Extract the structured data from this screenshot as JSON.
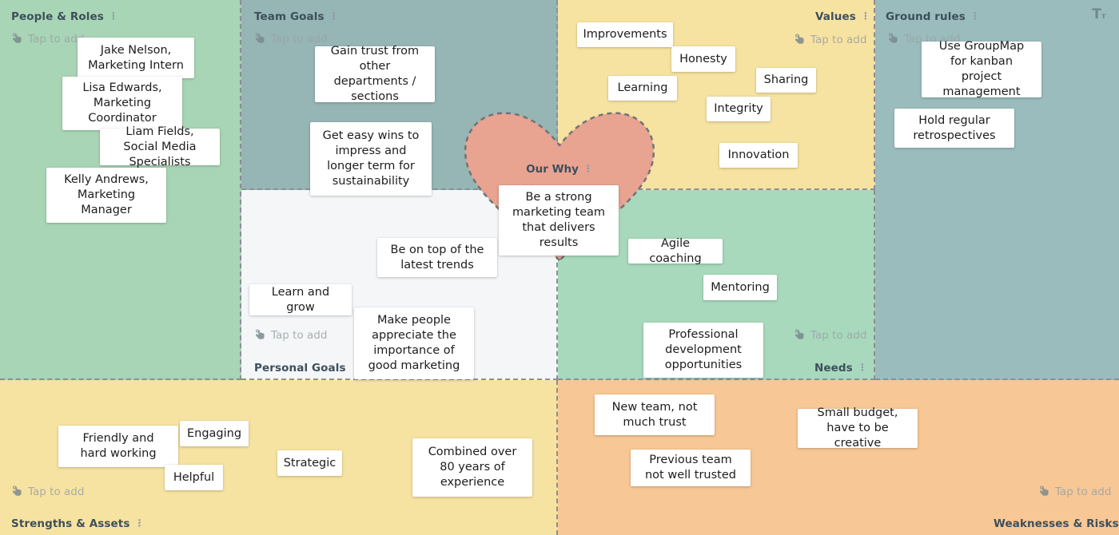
{
  "board": {
    "tap_to_add_label": "Tap to add",
    "menu_glyph": "⋮",
    "text_tool_label": "T",
    "text_tool_sub": "т"
  },
  "colors": {
    "people": "#a8d5b5",
    "team_goals": "#96b5b5",
    "personal_goals": "#f4f6f8",
    "values": "#f7e3a1",
    "needs": "#a8d9bd",
    "ground_rules": "#9bbcbc",
    "strengths": "#f7e3a1",
    "weaknesses": "#f7c795",
    "heart_fill": "#e8a391",
    "heart_stroke": "#6f7478",
    "title_text": "#3d4f5c",
    "card_bg": "#ffffff",
    "tap_text": "#9aa3a8"
  },
  "zones": {
    "people_roles": {
      "title": "People & Roles",
      "cards": [
        {
          "text": "Jake Nelson, Marketing Intern"
        },
        {
          "text": "Lisa Edwards, Marketing Coordinator"
        },
        {
          "text": "Liam Fields, Social Media Specialists"
        },
        {
          "text": "Kelly Andrews, Marketing Manager"
        }
      ]
    },
    "team_goals": {
      "title": "Team Goals",
      "cards": [
        {
          "text": "Gain trust from other departments / sections"
        },
        {
          "text": "Get easy wins to impress and longer term for sustainability"
        }
      ]
    },
    "personal_goals": {
      "title": "Personal Goals",
      "cards": [
        {
          "text": "Be on top of the latest trends"
        },
        {
          "text": "Learn and grow"
        },
        {
          "text": "Make people appreciate the importance of good marketing"
        }
      ]
    },
    "values": {
      "title": "Values",
      "cards": [
        {
          "text": "Improvements"
        },
        {
          "text": "Honesty"
        },
        {
          "text": "Sharing"
        },
        {
          "text": "Learning"
        },
        {
          "text": "Integrity"
        },
        {
          "text": "Innovation"
        }
      ]
    },
    "needs": {
      "title": "Needs",
      "cards": [
        {
          "text": "Agile coaching"
        },
        {
          "text": "Mentoring"
        },
        {
          "text": "Professional development opportunities"
        }
      ]
    },
    "ground_rules": {
      "title": "Ground rules",
      "cards": [
        {
          "text": "Use GroupMap for kanban project management"
        },
        {
          "text": "Hold regular retrospectives"
        }
      ]
    },
    "our_why": {
      "title": "Our Why",
      "cards": [
        {
          "text": "Be a strong marketing team that delivers results"
        }
      ]
    },
    "strengths_assets": {
      "title": "Strengths & Assets",
      "cards": [
        {
          "text": "Friendly and hard working"
        },
        {
          "text": "Engaging"
        },
        {
          "text": "Helpful"
        },
        {
          "text": "Strategic"
        },
        {
          "text": "Combined over 80 years of experience"
        }
      ]
    },
    "weaknesses_risks": {
      "title": "Weaknesses & Risks",
      "cards": [
        {
          "text": "New team, not much trust"
        },
        {
          "text": "Previous team not well trusted"
        },
        {
          "text": "Small budget, have to be creative"
        }
      ]
    }
  }
}
